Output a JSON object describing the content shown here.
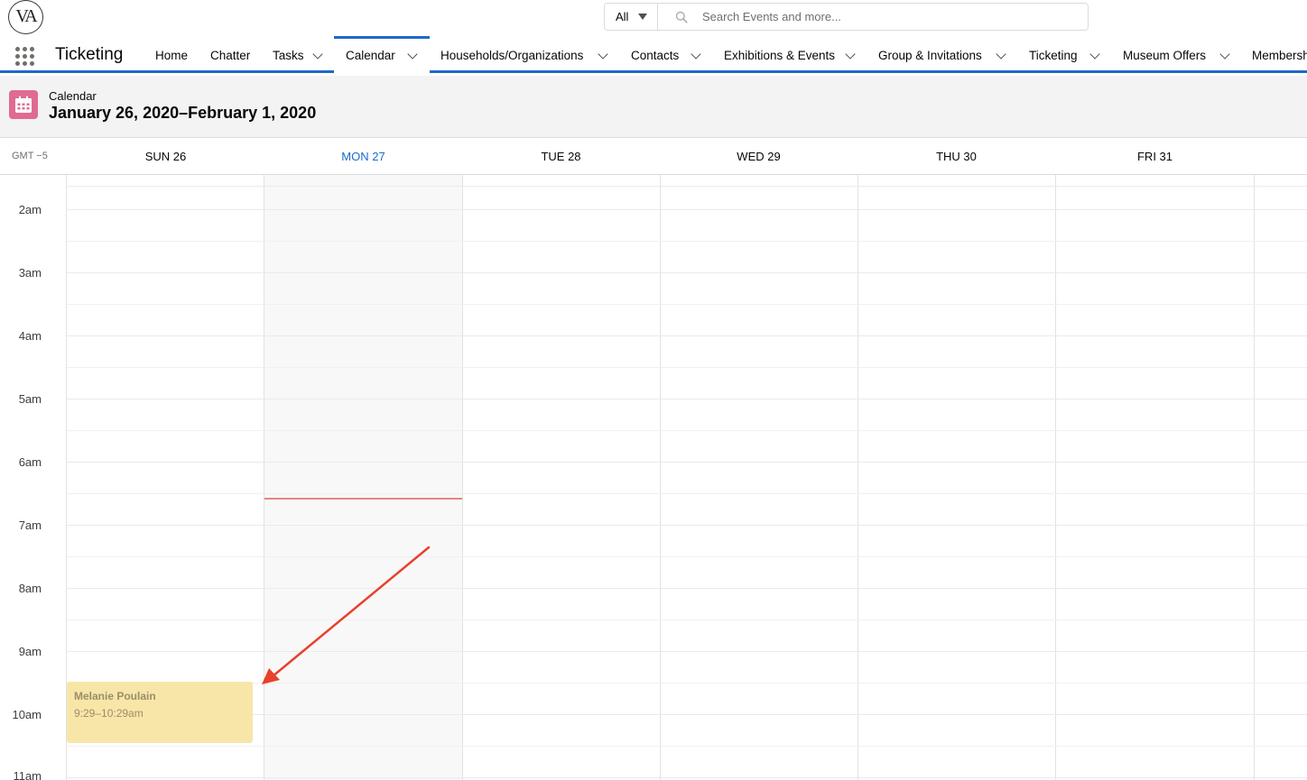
{
  "logo": {
    "text": "VA"
  },
  "search": {
    "scope": "All",
    "placeholder": "Search Events and more..."
  },
  "app": {
    "name": "Ticketing"
  },
  "nav": {
    "items": [
      {
        "label": "Home",
        "dropdown": false
      },
      {
        "label": "Chatter",
        "dropdown": false
      },
      {
        "label": "Tasks",
        "dropdown": true
      },
      {
        "label": "Calendar",
        "dropdown": true,
        "active": true
      },
      {
        "label": "Households/Organizations",
        "dropdown": true
      },
      {
        "label": "Contacts",
        "dropdown": true
      },
      {
        "label": "Exhibitions & Events",
        "dropdown": true
      },
      {
        "label": "Group & Invitations",
        "dropdown": true
      },
      {
        "label": "Ticketing",
        "dropdown": true
      },
      {
        "label": "Museum Offers",
        "dropdown": true
      },
      {
        "label": "Membersh",
        "dropdown": false
      }
    ]
  },
  "header": {
    "label": "Calendar",
    "title": "January 26, 2020–February 1, 2020",
    "icon": "calendar-icon",
    "icon_color": "#e06b92"
  },
  "calendar": {
    "timezone": "GMT −5",
    "days": [
      {
        "label": "SUN 26"
      },
      {
        "label": "MON 27",
        "today": true
      },
      {
        "label": "TUE 28"
      },
      {
        "label": "WED 29"
      },
      {
        "label": "THU 30"
      },
      {
        "label": "FRI 31"
      }
    ],
    "hours": [
      "2am",
      "3am",
      "4am",
      "5am",
      "6am",
      "7am",
      "8am",
      "9am",
      "10am",
      "11am"
    ],
    "event": {
      "title": "Melanie Poulain",
      "time": "9:29–10:29am",
      "color": "#f7e6a8"
    },
    "annotation_color": "#e8412c"
  }
}
